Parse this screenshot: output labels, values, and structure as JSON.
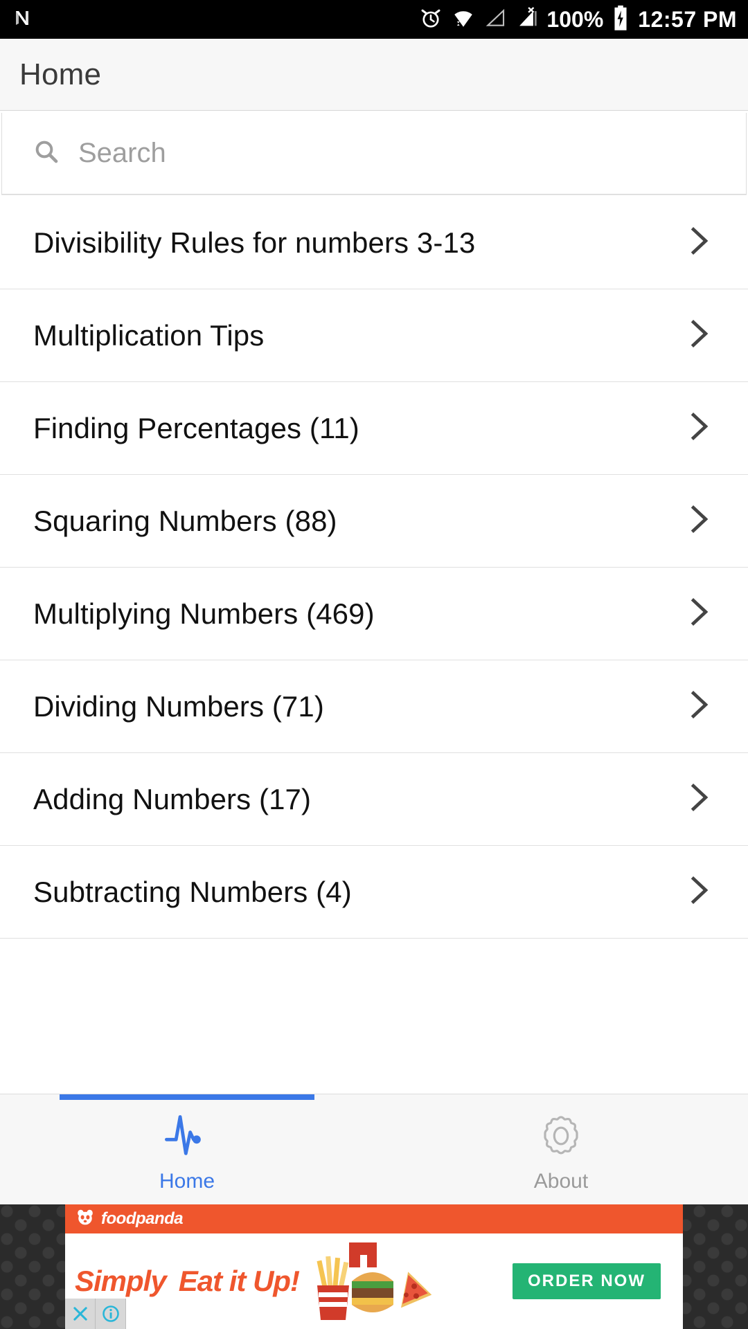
{
  "statusbar": {
    "os_logo_name": "android-nougat-logo",
    "icons": [
      "alarm-icon",
      "wifi-icon",
      "signal-1-icon",
      "signal-2-no-service-icon"
    ],
    "battery_percent": "100%",
    "battery_state_icon": "battery-charging-icon",
    "time": "12:57 PM"
  },
  "appbar": {
    "title": "Home"
  },
  "search": {
    "placeholder": "Search",
    "value": "",
    "icon": "search-icon"
  },
  "list": {
    "chevron_icon": "chevron-right-icon",
    "items": [
      {
        "label": "Divisibility Rules for numbers 3-13"
      },
      {
        "label": "Multiplication Tips"
      },
      {
        "label": "Finding Percentages (11)"
      },
      {
        "label": "Squaring Numbers (88)"
      },
      {
        "label": "Multiplying Numbers (469)"
      },
      {
        "label": "Dividing Numbers (71)"
      },
      {
        "label": "Adding Numbers (17)"
      },
      {
        "label": "Subtracting Numbers (4)"
      }
    ]
  },
  "bottomnav": {
    "active_color": "#3b78e7",
    "inactive_color": "#9a9a9a",
    "tabs": [
      {
        "label": "Home",
        "icon": "pulse-heartbeat-icon",
        "active": true
      },
      {
        "label": "About",
        "icon": "gear-icon",
        "active": false
      }
    ]
  },
  "ad": {
    "brand": "foodpanda",
    "brand_icon": "panda-icon",
    "headline_part1": "Simply",
    "headline_part2": "Eat it Up!",
    "cta_label": "ORDER NOW",
    "cta_color": "#24b474",
    "header_color": "#ef562d",
    "close_icon": "close-icon",
    "info_icon": "info-icon"
  }
}
